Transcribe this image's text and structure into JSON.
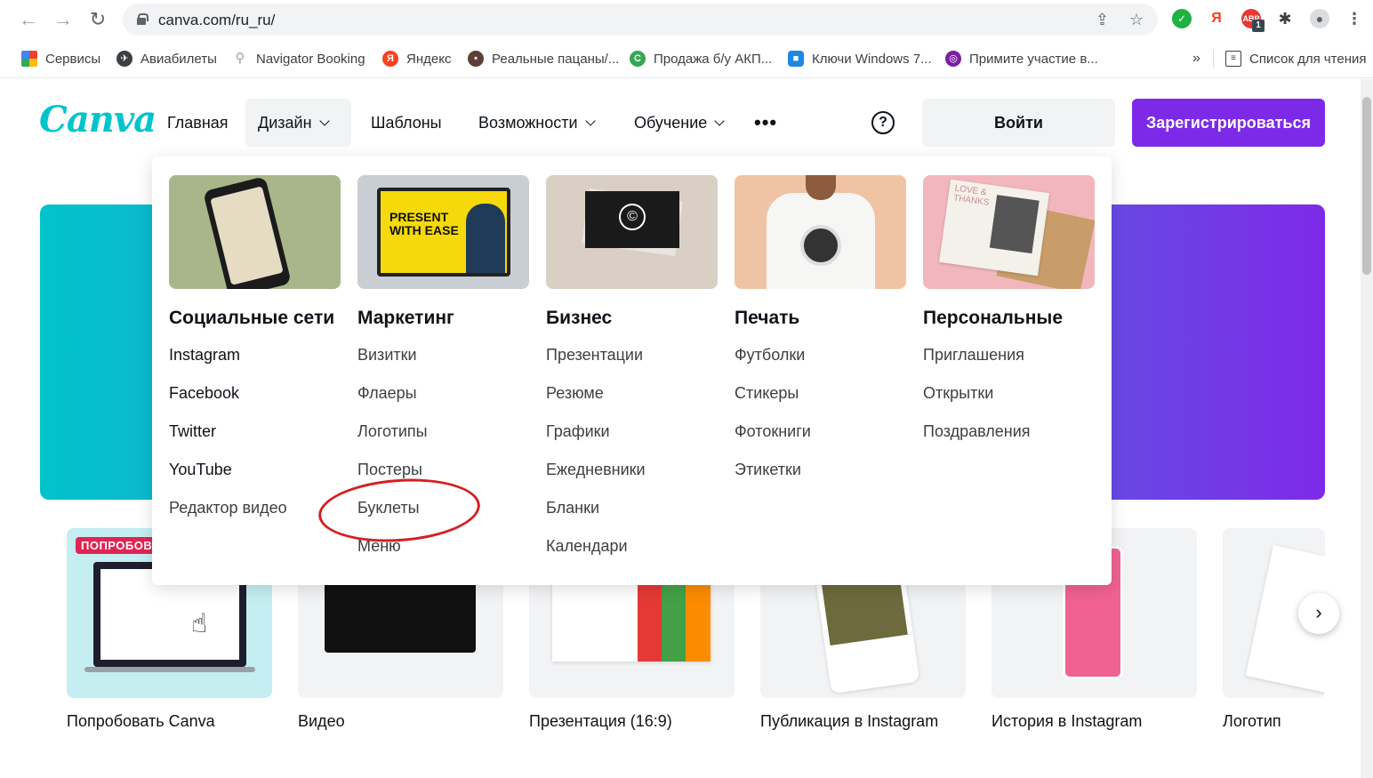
{
  "browser": {
    "url": "canva.com/ru_ru/",
    "bookmarks": [
      {
        "label": "Сервисы",
        "icon": "apps-grid-icon",
        "color": "#ea4335"
      },
      {
        "label": "Авиабилеты",
        "icon": "plane-icon",
        "color": "#3c4043"
      },
      {
        "label": "Navigator Booking",
        "icon": "figure-icon",
        "color": "#9aa0a6"
      },
      {
        "label": "Яндекс",
        "icon": "yandex-icon",
        "color": "#fc3f1d"
      },
      {
        "label": "Реальные пацаны/...",
        "icon": "bug-icon",
        "color": "#5d4037"
      },
      {
        "label": "Продажа б/у АКП...",
        "icon": "c-green-icon",
        "color": "#34a853"
      },
      {
        "label": "Ключи Windows 7...",
        "icon": "blue-square-icon",
        "color": "#1e88e5"
      },
      {
        "label": "Примите участие в...",
        "icon": "target-icon",
        "color": "#7b1fa2"
      }
    ],
    "more_bookmarks": "»",
    "reading_list": "Список для чтения",
    "extension_badge": "1"
  },
  "nav": {
    "logo": "Canva",
    "items": [
      {
        "label": "Главная",
        "dropdown": false
      },
      {
        "label": "Дизайн",
        "dropdown": true,
        "active": true
      },
      {
        "label": "Шаблоны",
        "dropdown": false
      },
      {
        "label": "Возможности",
        "dropdown": true
      },
      {
        "label": "Обучение",
        "dropdown": true
      }
    ],
    "more": "•••",
    "help": "?",
    "login": "Войти",
    "signup": "Зарегистрироваться"
  },
  "design_menu": [
    {
      "heading": "Социальные сети",
      "image": "phone-mockup",
      "items": [
        "Instagram",
        "Facebook",
        "Twitter",
        "YouTube",
        "Редактор видео"
      ]
    },
    {
      "heading": "Маркетинг",
      "image": "present-with-ease",
      "image_text": "PRESENT WITH EASE",
      "items": [
        "Визитки",
        "Флаеры",
        "Логотипы",
        "Постеры",
        "Буклеты",
        "Меню"
      ]
    },
    {
      "heading": "Бизнес",
      "image": "business-card",
      "image_text": "©",
      "items": [
        "Презентации",
        "Резюме",
        "Графики",
        "Ежедневники",
        "Бланки",
        "Календари"
      ]
    },
    {
      "heading": "Печать",
      "image": "tshirt",
      "items": [
        "Футболки",
        "Стикеры",
        "Фотокниги",
        "Этикетки"
      ]
    },
    {
      "heading": "Персональные",
      "image": "cards-envelope",
      "image_text": "LOVE & THANKS",
      "items": [
        "Приглашения",
        "Открытки",
        "Поздравления"
      ]
    }
  ],
  "templates": [
    {
      "label": "Попробовать Canva",
      "badge": "ПОПРОБОВА"
    },
    {
      "label": "Видео"
    },
    {
      "label": "Презентация (16:9)"
    },
    {
      "label": "Публикация в Instagram"
    },
    {
      "label": "История в Instagram"
    },
    {
      "label": "Логотип"
    }
  ],
  "carousel_next": "›",
  "colors": {
    "brand": "#00c4cc",
    "accent": "#7d2ae8",
    "annotation": "#d42020"
  }
}
